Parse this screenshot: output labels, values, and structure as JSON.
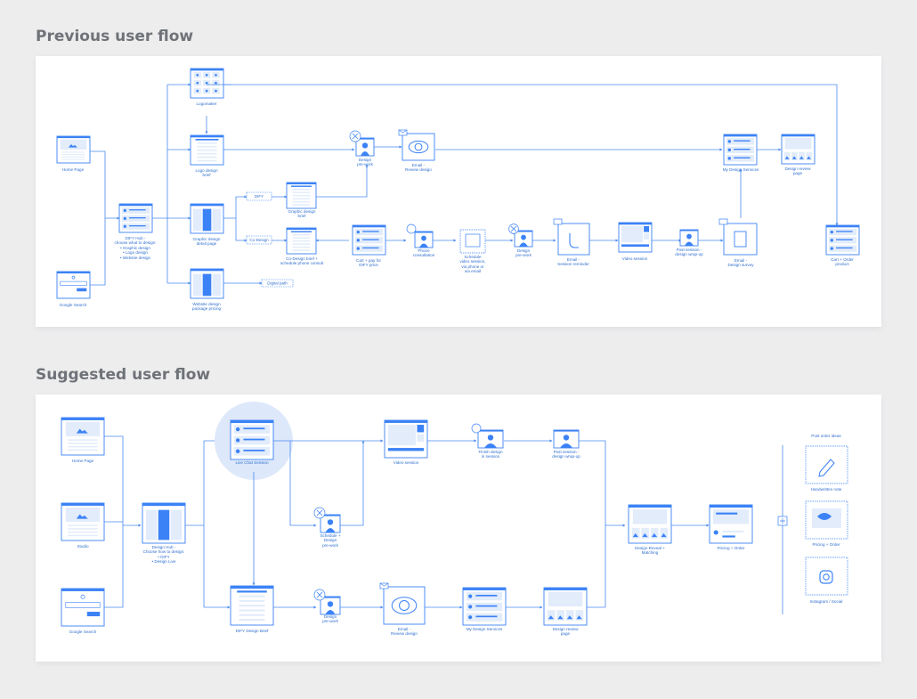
{
  "titles": {
    "previous": "Previous user flow",
    "suggested": "Suggested user flow"
  },
  "colors": {
    "accent": "#3b82f6",
    "line": "#4a8af0",
    "fill_light": "#e2ecfb",
    "circle_bg": "#dde8fa",
    "text": "#2f6fcf"
  },
  "previous": {
    "home_page": "Home Page",
    "google_search": "Google Search",
    "difx_hub": "DIFY Hub -\nchoose what to design:\n• Graphic design\n• Logo design\n• Website design",
    "logomaker": "Logomaker",
    "logo_brief": "Logo design\nbrief",
    "graphic_detail": "Graphic design\ndetail page",
    "website_pricing": "Website design\npackage pricing",
    "difx_tag": "DIFY",
    "codesign_tag": "Co-Design",
    "digital_path": "Digital path",
    "graphic_brief": "Graphic design\nbrief",
    "codesign_brief": "Co-Design brief +\nschedule phone consult",
    "cart_pay": "Cart + pay for\nDIFY price",
    "phone_consult": "Phone\nconsultation",
    "schedule_video": "Schedule\nvideo session,\nvia phone or\nvia email",
    "design_prework_mid": "Design\npre-work",
    "design_prework_top": "Design\npre-work",
    "email_review": "Email -\nReview design",
    "email_reminder": "Email -\nSession reminder",
    "video_session": "Video session",
    "post_session": "Post session -\ndesign wrap-up",
    "email_survey": "Email -\nDesign survey",
    "my_design_services": "My Design Services",
    "design_review": "Design review\npage",
    "cart_order": "Cart + Order\nproduct"
  },
  "suggested": {
    "home_page": "Home Page",
    "studio": "Studio",
    "google_search": "Google Search",
    "design_hub": "Design Hub -\nChoose how to design:\n• DIFY\n• Design Live",
    "live_chat": "Live Chat Session",
    "difx_brief": "DIFY Design Brief",
    "video_session": "Video session",
    "finish_design": "Finish design\nin session",
    "post_session": "Post session -\ndesign wrap-up",
    "schedule_prework": "Schedule +\nDesign\npre-work",
    "design_prework": "Design\npre-work",
    "email_review": "Email -\nReview design",
    "my_design_services": "My Design Services",
    "design_review": "Design review\npage",
    "design_reveal": "Design Reveal +\nMatching",
    "pricing_order": "Pricing + Order",
    "post_order_ideas": "Post order ideas",
    "handwritten_note": "Handwritten note",
    "pricing_order2": "Pricing + Order",
    "instagram_social": "Instagram / Social"
  }
}
